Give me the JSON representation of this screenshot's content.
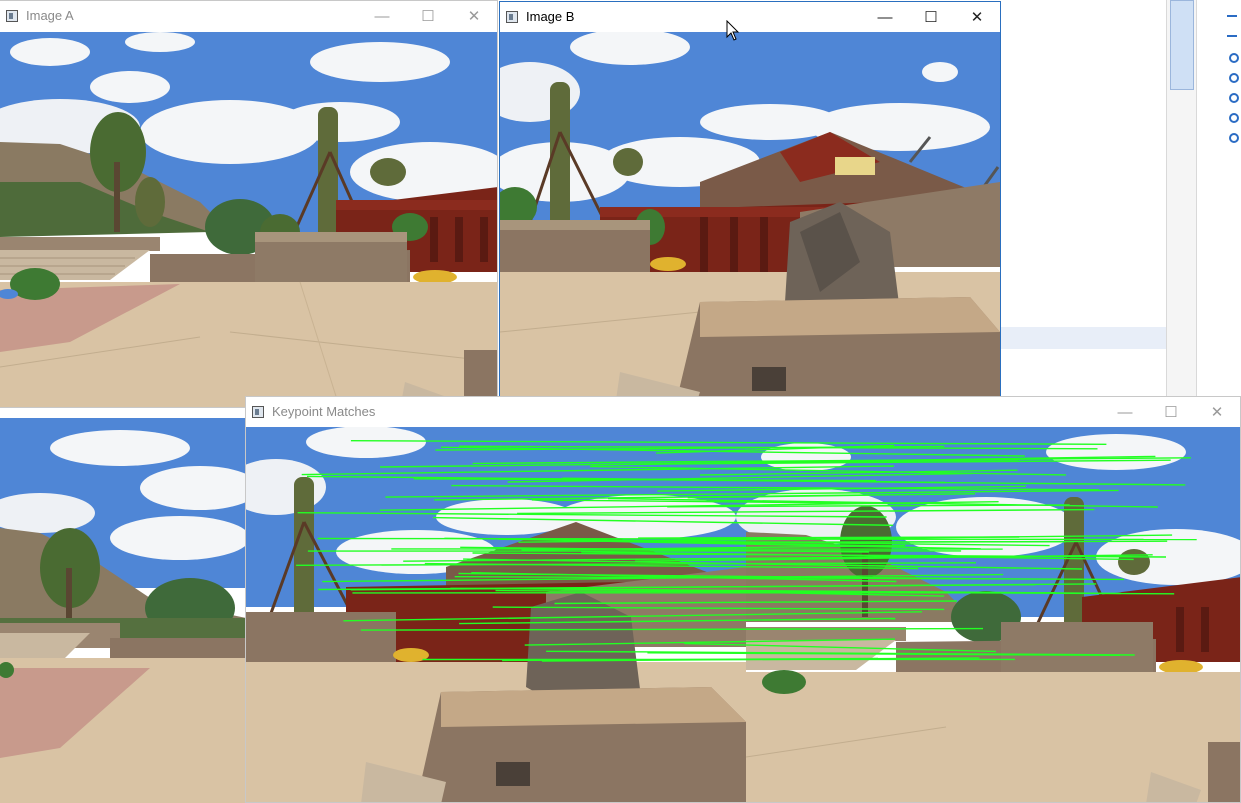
{
  "windows": {
    "image_a": {
      "title": "Image A",
      "controls": {
        "minimize": "—",
        "maximize": "☐",
        "close": "✕"
      }
    },
    "image_b": {
      "title": "Image B",
      "controls": {
        "minimize": "—",
        "maximize": "☐",
        "close": "✕"
      }
    },
    "keypoint_matches": {
      "title": "Keypoint Matches",
      "controls": {
        "minimize": "—",
        "maximize": "☐",
        "close": "✕"
      }
    }
  },
  "colors": {
    "match_line": "#22ff22",
    "sky": "#4f86d6",
    "cloud": "#f4f6f8",
    "hill": "#8a7a62",
    "cactus": "#5f6b3a",
    "wall_red": "#7a2418",
    "stone": "#9a8570",
    "pavement": "#d9c3a4",
    "window_border_active": "#2a6fbf"
  },
  "icons": {
    "window_app": "opencv-window-icon",
    "minimize": "minimize-icon",
    "maximize": "maximize-icon",
    "close": "close-icon",
    "cursor": "mouse-pointer-icon"
  }
}
